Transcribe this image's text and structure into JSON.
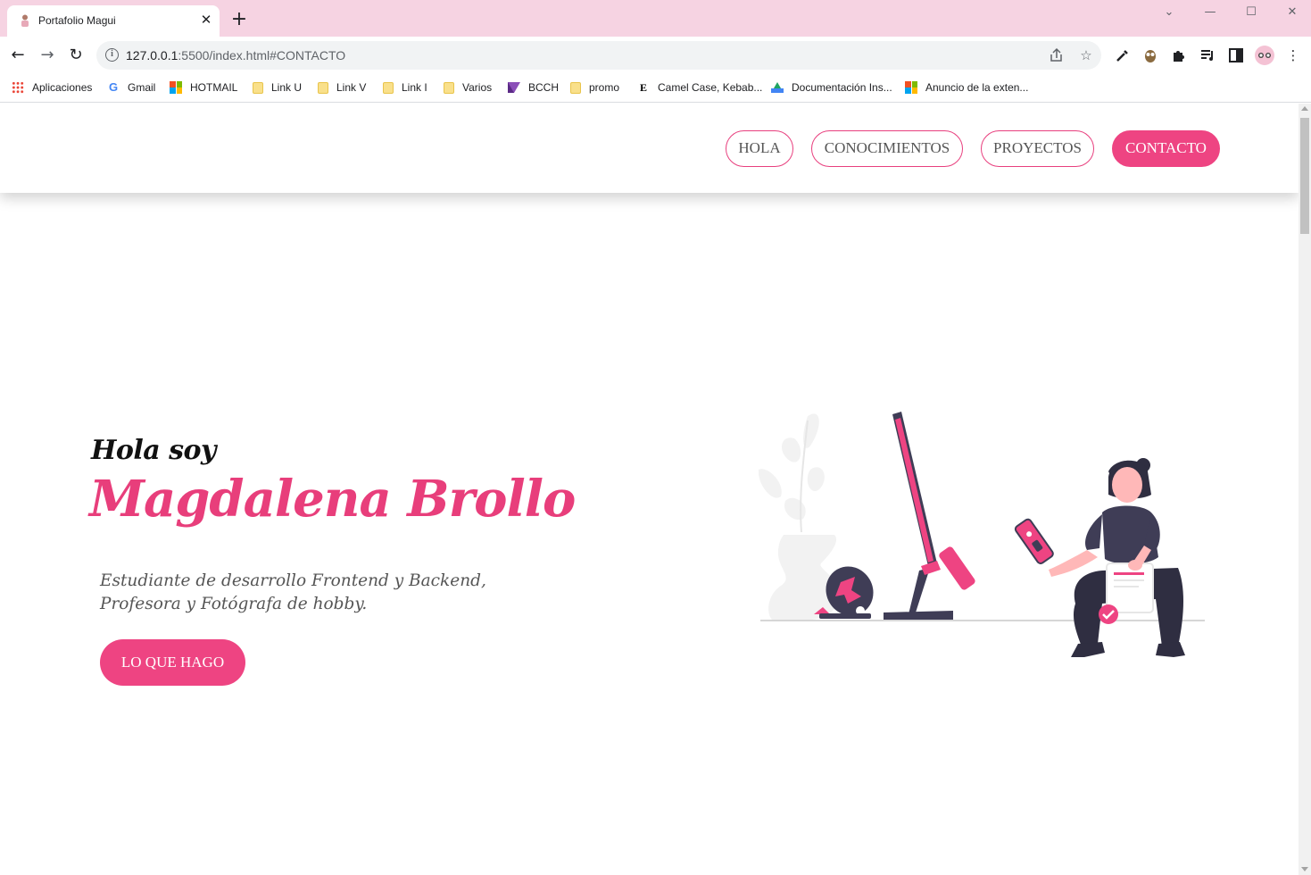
{
  "browser": {
    "tab": {
      "title": "Portafolio Magui"
    },
    "window_controls": {
      "minimize": "—",
      "maximize": "☐",
      "close": "✕",
      "tab_search": "⌄"
    },
    "address": {
      "host": "127.0.0.1",
      "rest": ":5500/index.html#CONTACTO"
    },
    "bookmarks": [
      {
        "label": "Aplicaciones",
        "icon": "apps-grid-icon"
      },
      {
        "label": "Gmail",
        "icon": "google-icon"
      },
      {
        "label": "HOTMAIL",
        "icon": "microsoft-icon"
      },
      {
        "label": "Link U",
        "icon": "folder-icon"
      },
      {
        "label": "Link V",
        "icon": "folder-icon"
      },
      {
        "label": "Link I",
        "icon": "folder-icon"
      },
      {
        "label": "Varios",
        "icon": "folder-icon"
      },
      {
        "label": "BCCH",
        "icon": "bcch-icon"
      },
      {
        "label": "promo",
        "icon": "folder-icon"
      },
      {
        "label": "Camel Case, Kebab...",
        "icon": "e-icon"
      },
      {
        "label": "Documentación Ins...",
        "icon": "google-drive-icon"
      },
      {
        "label": "Anuncio de la exten...",
        "icon": "microsoft-icon"
      }
    ]
  },
  "nav": {
    "items": [
      {
        "label": "HOLA",
        "active": false
      },
      {
        "label": "CONOCIMIENTOS",
        "active": false
      },
      {
        "label": "PROYECTOS",
        "active": false
      },
      {
        "label": "CONTACTO",
        "active": true
      }
    ]
  },
  "hero": {
    "greeting": "Hola soy",
    "name": "Magdalena Brollo",
    "description": "Estudiante de desarrollo Frontend y Backend, Profesora y Fotógrafa de hobby.",
    "cta_label": "LO QUE HAGO"
  },
  "colors": {
    "accent": "#ee4482",
    "tabbar": "#f6d3e2",
    "illustration_dark": "#3f3d56",
    "illustration_light": "#f2f2f2"
  }
}
